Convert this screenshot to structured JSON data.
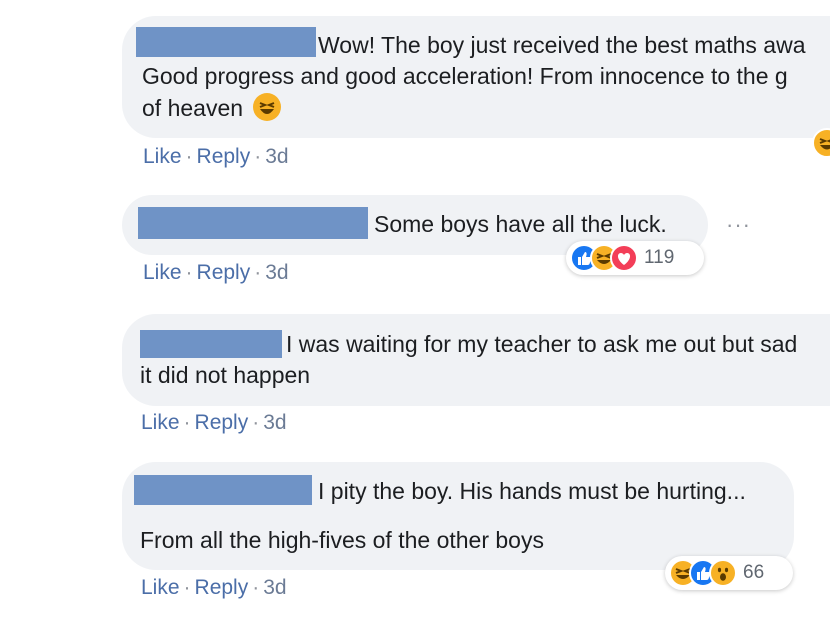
{
  "actions": {
    "like": "Like",
    "reply": "Reply",
    "separator": "·"
  },
  "comments": [
    {
      "line1": "Wow! The boy just received the best maths awa",
      "line2": "Good progress and good acceleration! From innocence to the g",
      "line3": "of heaven",
      "time": "3d",
      "inline_emoji": "haha-emoji-icon"
    },
    {
      "line1": "Some boys have all the luck.",
      "time": "3d",
      "reactions": [
        "like",
        "haha",
        "love"
      ],
      "reaction_count": "119",
      "more": "···"
    },
    {
      "line1": "I was waiting for my teacher to ask me out but sad",
      "line2": "it did not happen",
      "time": "3d"
    },
    {
      "line1": "I pity the boy. His hands must be hurting...",
      "line2": "From all the high-fives of the other boys",
      "time": "3d",
      "reactions": [
        "haha",
        "like",
        "wow"
      ],
      "reaction_count": "66"
    }
  ],
  "colors": {
    "bubble_bg": "#f0f2f5",
    "name_redaction": "#6f93c6",
    "link_blue": "#4b6ea8",
    "like_blue": "#1877f2",
    "haha_yellow": "#f7b125",
    "love_red": "#f33e58"
  }
}
